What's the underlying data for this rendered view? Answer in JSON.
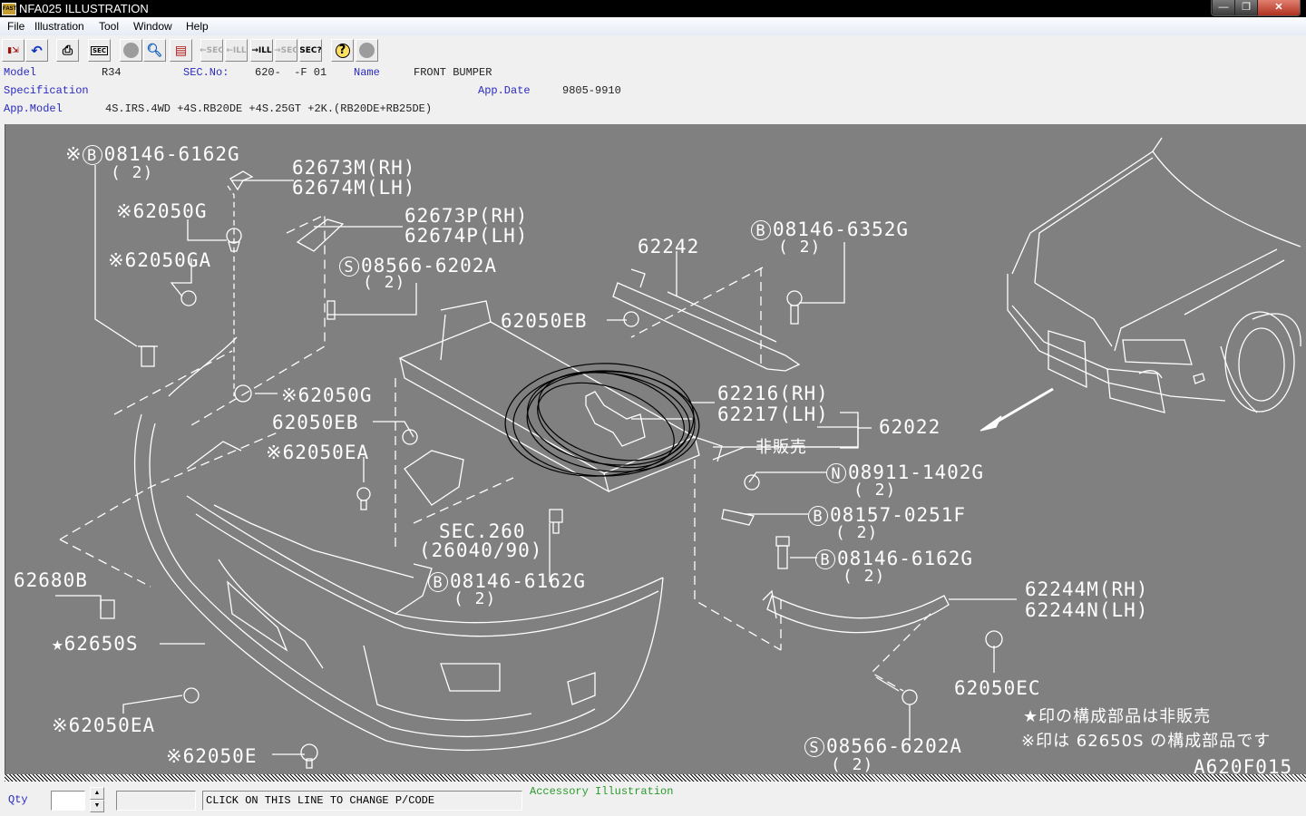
{
  "window": {
    "title": "NFA025  ILLUSTRATION",
    "app_icon_text": "FAST",
    "controls": {
      "minimize": "—",
      "restore": "❐",
      "close": "✕"
    }
  },
  "menu": [
    "File",
    "Illustration",
    "Tool",
    "Window",
    "Help"
  ],
  "toolbar": [
    {
      "name": "exit",
      "glyph": "🚪",
      "enabled": true
    },
    {
      "name": "undo",
      "glyph": "↶",
      "enabled": true
    },
    {
      "name": "print",
      "glyph": "🖶",
      "enabled": true
    },
    {
      "name": "sec-index",
      "glyph": "SEC",
      "enabled": true
    },
    {
      "name": "disabled-circle-1",
      "glyph": "",
      "enabled": false
    },
    {
      "name": "zoom-search",
      "glyph": "🔍",
      "enabled": true
    },
    {
      "name": "book",
      "glyph": "📕",
      "enabled": true
    },
    {
      "name": "prev-sec",
      "glyph": "←SEC.",
      "enabled": false
    },
    {
      "name": "prev-ill",
      "glyph": "←ILL.",
      "enabled": false
    },
    {
      "name": "next-ill",
      "glyph": "→ILL.",
      "enabled": true
    },
    {
      "name": "next-sec",
      "glyph": "→SEC.",
      "enabled": false
    },
    {
      "name": "sec-query",
      "glyph": "SEC?",
      "enabled": true
    },
    {
      "name": "help",
      "glyph": "?",
      "enabled": true
    },
    {
      "name": "disabled-circle-2",
      "glyph": "",
      "enabled": false
    }
  ],
  "info": {
    "model_label": "Model",
    "model_value": "R34",
    "sec_label": "SEC.No:",
    "sec_value": "620-  -F 01",
    "name_label": "Name",
    "name_value": "FRONT BUMPER",
    "spec_label": "Specification",
    "spec_value": "",
    "appdate_label": "App.Date",
    "appdate_value": "9805-9910",
    "appmodel_label": "App.Model",
    "appmodel_value": "4S.IRS.4WD +4S.RB20DE +4S.25GT +2K.(RB20DE+RB25DE)"
  },
  "illustration": {
    "id": "A620F015",
    "selected_part": "08146-6162G",
    "labels": [
      {
        "prefix": "※",
        "circle": "B",
        "text": "08146-6162G",
        "qty": "( 2)",
        "selected": true
      },
      {
        "text": "62673M(RH)"
      },
      {
        "text": "62674M(LH)"
      },
      {
        "prefix": "※",
        "text": "62050G"
      },
      {
        "prefix": "※",
        "text": "62050GA"
      },
      {
        "text": "62673P(RH)"
      },
      {
        "text": "62674P(LH)"
      },
      {
        "circle": "S",
        "text": "08566-6202A",
        "qty": "( 2)"
      },
      {
        "text": "62242"
      },
      {
        "circle": "B",
        "text": "08146-6352G",
        "qty": "( 2)"
      },
      {
        "text": "62050EB"
      },
      {
        "prefix": "※",
        "text": "62050G"
      },
      {
        "text": "62050EB"
      },
      {
        "prefix": "※",
        "text": "62050EA"
      },
      {
        "text": "62216(RH)"
      },
      {
        "text": "62217(LH)"
      },
      {
        "text": "62022"
      },
      {
        "text": "非販売"
      },
      {
        "circle": "N",
        "text": "08911-1402G",
        "qty": "( 2)"
      },
      {
        "text": "SEC.260"
      },
      {
        "text": "(26040/90)"
      },
      {
        "circle": "B",
        "text": "08157-0251F",
        "qty": "( 2)"
      },
      {
        "circle": "B",
        "text": "08146-6162G",
        "qty": "( 2)"
      },
      {
        "circle": "B",
        "text": "08146-6162G",
        "qty": "( 2)"
      },
      {
        "text": "62680B"
      },
      {
        "prefix": "★",
        "text": "62650S"
      },
      {
        "text": "62244M(RH)"
      },
      {
        "text": "62244N(LH)"
      },
      {
        "text": "62050EC"
      },
      {
        "prefix": "※",
        "text": "62050EA"
      },
      {
        "prefix": "※",
        "text": "62050E"
      },
      {
        "circle": "S",
        "text": "08566-6202A",
        "qty": "( 2)"
      }
    ],
    "notes": [
      "★印の構成部品は非販売",
      "※印は 62650S の構成部品です"
    ]
  },
  "statusbar": {
    "qty_label": "Qty",
    "qty_value": "",
    "code_value": "",
    "pcode_text": "CLICK ON THIS LINE TO CHANGE P/CODE",
    "accessory_link": "Accessory Illustration"
  }
}
